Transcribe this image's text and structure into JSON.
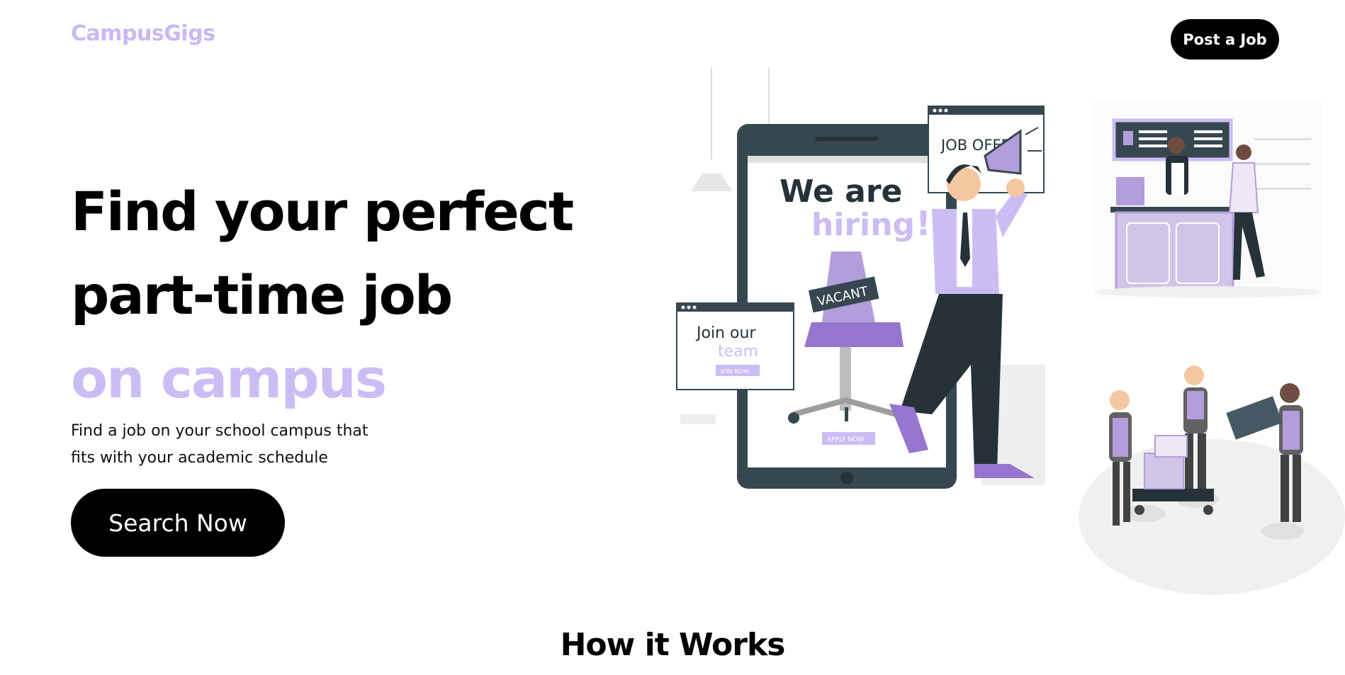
{
  "header": {
    "logo": "CampusGigs",
    "post_job_label": "Post a Job"
  },
  "hero": {
    "title_line1": "Find your perfect",
    "title_line2": "part-time job",
    "title_accent": "on campus",
    "subtitle_line1": "Find a job on your school campus that",
    "subtitle_line2": "fits with your academic schedule",
    "search_label": "Search Now"
  },
  "illustration_text": {
    "job_offer": "JOB OFFER",
    "we_are": "We are",
    "hiring": "hiring",
    "exclaim": "!",
    "vacant": "VACANT",
    "join_our": "Join our",
    "team": "team",
    "join_now": "JOIN NOW",
    "apply_now": "APPLY NOW"
  },
  "how_it_works": {
    "title": "How it Works"
  },
  "colors": {
    "accent": "#cbbdf4",
    "logo": "#c9b8f2",
    "dark": "#37474f",
    "button": "#000000"
  }
}
